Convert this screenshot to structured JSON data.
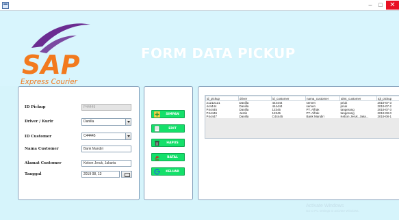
{
  "window": {
    "min_glyph": "–",
    "max_glyph": "□",
    "close_glyph": "✕"
  },
  "header": {
    "logo_text": "SAP",
    "logo_sub": "Express Courier",
    "title": "FORM DATA PICKUP"
  },
  "form": {
    "id_pickup": {
      "label": "ID Pickup",
      "value": "P44449"
    },
    "driver": {
      "label": "Driver / Kurir",
      "value": "Danilla"
    },
    "id_customer": {
      "label": "ID Customer",
      "value": "C44445"
    },
    "nama_customer": {
      "label": "Nama Customer",
      "value": "Bank Mandiri"
    },
    "alamat_customer": {
      "label": "Alamat Customer",
      "value": "Kebon Jeruk, Jakarta"
    },
    "tanggal": {
      "label": "Tanggal",
      "value": "2019 08, 13"
    }
  },
  "buttons": {
    "simpan": "SIMPAN",
    "edit": "EDIT",
    "hapus": "HAPUS",
    "batal": "BATAL",
    "keluar": "KELUAR"
  },
  "table": {
    "headers": [
      "id_pickup",
      "driver",
      "id_customer",
      "nama_customer",
      "almt_customer",
      "tgl_pickup"
    ],
    "rows": [
      [
        "21212121",
        "Danilla",
        "444444",
        "semen",
        "priuk",
        "2019-07-3"
      ],
      [
        "444444",
        "Danilla",
        "444444",
        "semen",
        "priuk",
        "2019-07-2"
      ],
      [
        "P44445",
        "Danilla",
        "12345",
        "PT. Alfrak",
        "tangerang",
        "2019-07-3"
      ],
      [
        "P44446",
        "Justin",
        "12345",
        "PT. Alfrak",
        "tangerang",
        "2019-08-0"
      ],
      [
        "P44447",
        "Danilla",
        "C44445",
        "Bank Mandiri",
        "Kebon Jeruk, Jaka...",
        "2019-08-1"
      ]
    ]
  },
  "watermark": {
    "title": "Activate Windows",
    "subtitle": "Go to PC settings to activate Windows."
  },
  "colors": {
    "background": "#d6f4fb",
    "button_green": "#14e06a",
    "logo_orange": "#f27a1e",
    "logo_purple": "#6b2c91",
    "title_white": "#ffffff"
  }
}
